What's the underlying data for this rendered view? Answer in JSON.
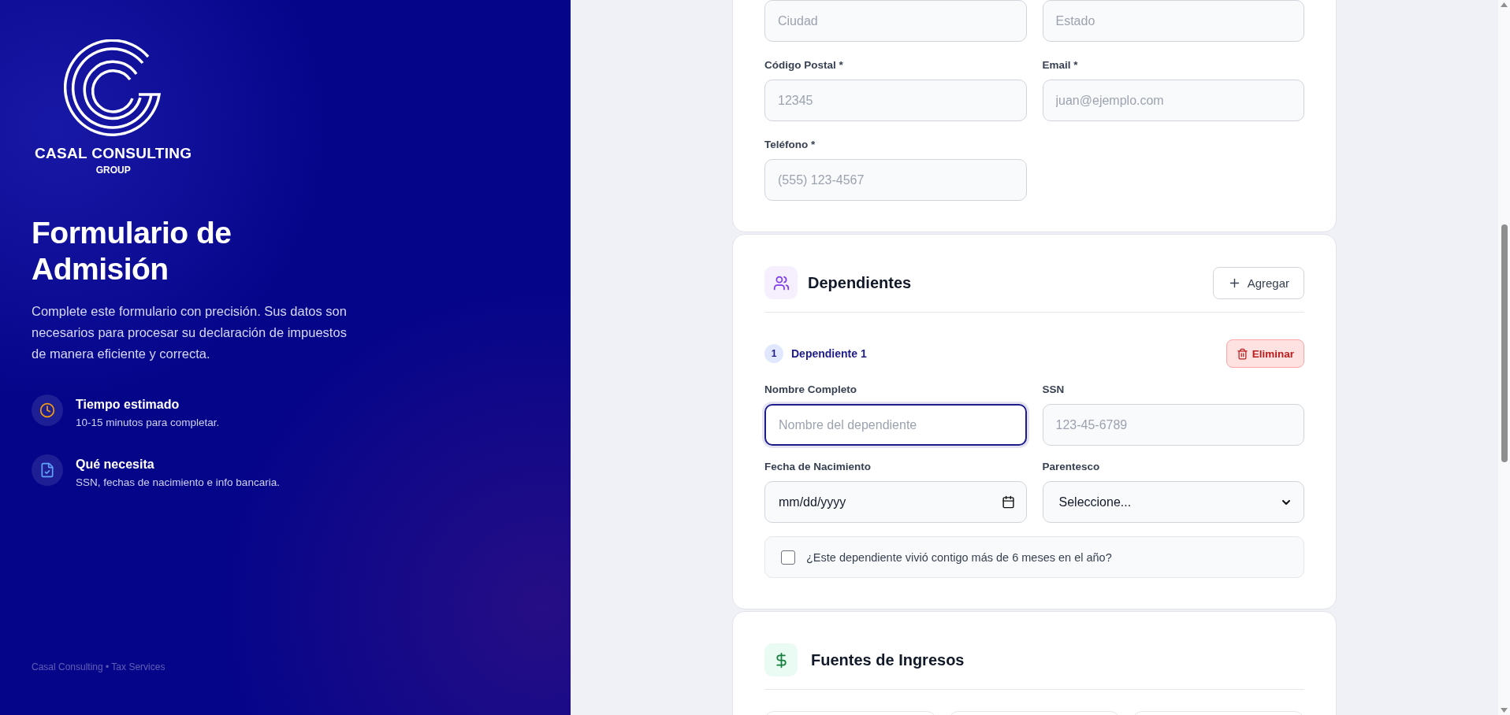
{
  "sidebar": {
    "brand": "CASAL CONSULTING",
    "brand_sub": "GROUP",
    "title": "Formulario de Admisión",
    "description": "Complete este formulario con precisión. Sus datos son necesarios para procesar su declaración de impuestos de manera eficiente y correcta.",
    "info_items": [
      {
        "kind": "clock",
        "title": "Tiempo estimado",
        "text": "10-15 minutos para completar."
      },
      {
        "kind": "document",
        "title": "Qué necesita",
        "text": "SSN, fechas de nacimiento e info bancaria."
      }
    ],
    "footer": "Casal Consulting • Tax Services"
  },
  "contact_section": {
    "fields": [
      {
        "placeholder": "Ciudad"
      },
      {
        "placeholder": "Estado"
      },
      {
        "label": "Código Postal *",
        "placeholder": "12345"
      },
      {
        "label": "Email *",
        "placeholder": "juan@ejemplo.com"
      },
      {
        "label": "Teléfono *",
        "placeholder": "(555) 123-4567"
      }
    ]
  },
  "dependents_section": {
    "title": "Dependientes",
    "add_button": "Agregar",
    "dependents": [
      {
        "number": "1",
        "title": "Dependiente 1",
        "remove_button": "Eliminar",
        "fields": [
          {
            "kind": "text",
            "label": "Nombre Completo",
            "placeholder": "Nombre del dependiente",
            "focused": true
          },
          {
            "kind": "text",
            "label": "SSN",
            "placeholder": "123-45-6789",
            "focused": false
          },
          {
            "kind": "date",
            "label": "Fecha de Nacimiento",
            "value": "mm/dd/yyyy"
          },
          {
            "kind": "select",
            "label": "Parentesco",
            "value": "Seleccione..."
          }
        ],
        "lived_with": {
          "label": "¿Este dependiente vivió contigo más de 6 meses en el año?",
          "checked": false
        }
      }
    ]
  },
  "income_section": {
    "title": "Fuentes de Ingresos"
  }
}
